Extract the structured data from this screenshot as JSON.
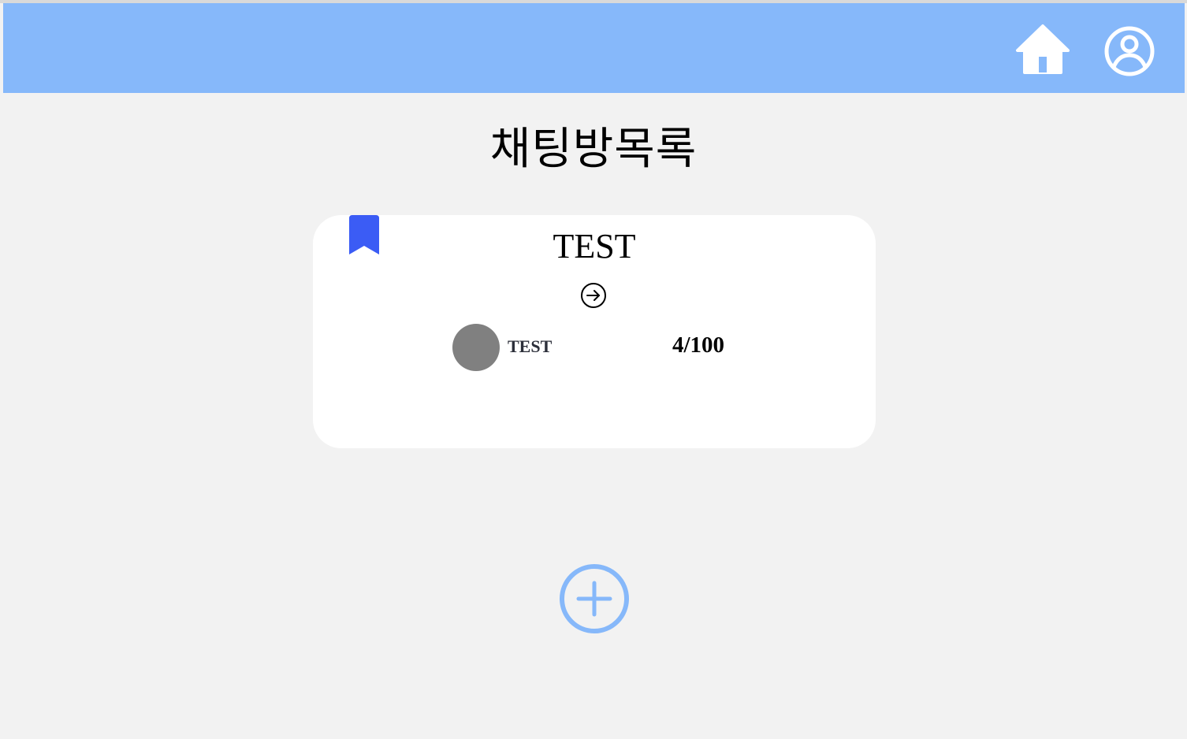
{
  "header": {
    "home_icon": "home-icon",
    "profile_icon": "user-circle-icon",
    "background_color": "#86b8fa"
  },
  "main": {
    "title": "채팅방목록"
  },
  "rooms": [
    {
      "title": "TEST",
      "bookmarked": true,
      "owner_name": "TEST",
      "members": "4/100",
      "bookmark_color": "#3b5cf5"
    }
  ],
  "actions": {
    "add_icon": "plus-circle-icon",
    "add_color": "#86b8fa"
  }
}
